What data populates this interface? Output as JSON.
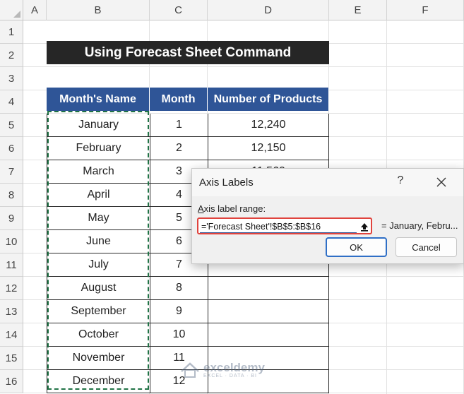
{
  "columns": [
    "A",
    "B",
    "C",
    "D",
    "E",
    "F"
  ],
  "rows": [
    "1",
    "2",
    "3",
    "4",
    "5",
    "6",
    "7",
    "8",
    "9",
    "10",
    "11",
    "12",
    "13",
    "14",
    "15",
    "16"
  ],
  "title": "Using Forecast Sheet Command",
  "table": {
    "headers": [
      "Month's Name",
      "Month",
      "Number of Products"
    ],
    "rows": [
      [
        "January",
        "1",
        "12,240"
      ],
      [
        "February",
        "2",
        "12,150"
      ],
      [
        "March",
        "3",
        "11,560"
      ],
      [
        "April",
        "4",
        ""
      ],
      [
        "May",
        "5",
        ""
      ],
      [
        "June",
        "6",
        ""
      ],
      [
        "July",
        "7",
        ""
      ],
      [
        "August",
        "8",
        ""
      ],
      [
        "September",
        "9",
        ""
      ],
      [
        "October",
        "10",
        ""
      ],
      [
        "November",
        "11",
        ""
      ],
      [
        "December",
        "12",
        ""
      ]
    ]
  },
  "dialog": {
    "title": "Axis Labels",
    "help": "?",
    "label_accel": "A",
    "label_rest": "xis label range:",
    "range_value": "='Forecast Sheet'!$B$5:$B$16",
    "preview": "= January, Febru...",
    "ok": "OK",
    "cancel": "Cancel"
  },
  "watermark": {
    "name": "exceldemy",
    "tagline": "EXCEL · DATA · BI"
  },
  "colors": {
    "header_blue": "#2f5597",
    "title_black": "#262626",
    "selection_green": "#217346",
    "highlight_red": "#e0433d"
  }
}
